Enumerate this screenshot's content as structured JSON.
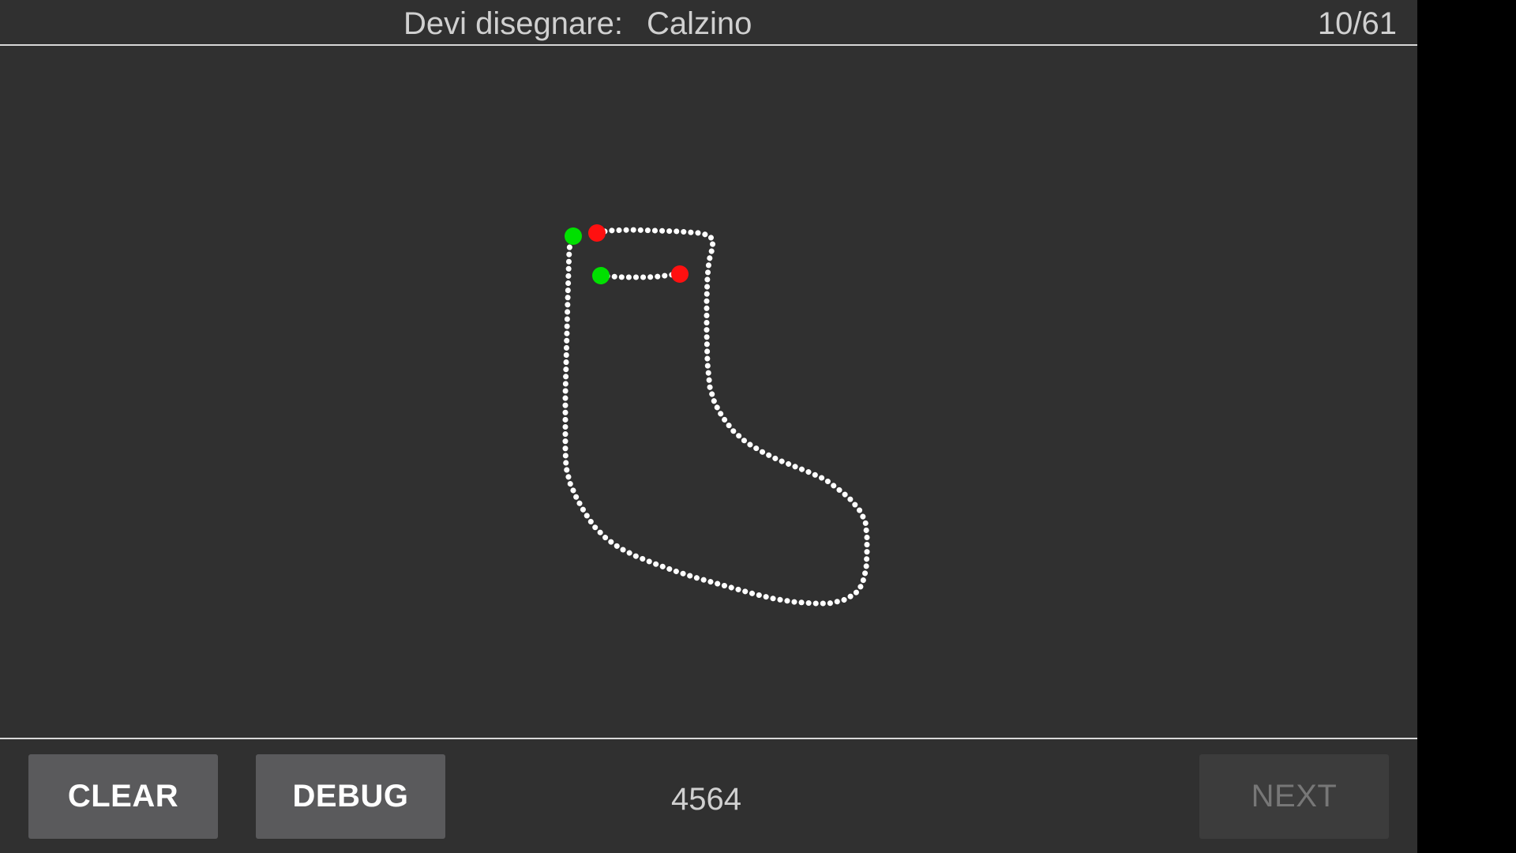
{
  "header": {
    "prompt_label": "Devi disegnare:",
    "prompt_word": "Calzino",
    "progress": "10/61"
  },
  "footer": {
    "clear_label": "CLEAR",
    "debug_label": "DEBUG",
    "score": "4564",
    "next_label": "NEXT",
    "next_enabled": false
  },
  "colors": {
    "background": "#303030",
    "stroke": "#ffffff",
    "stroke_start": "#00e000",
    "stroke_end": "#ff1010",
    "button": "#5a5a5c",
    "button_disabled": "#3c3c3c"
  }
}
